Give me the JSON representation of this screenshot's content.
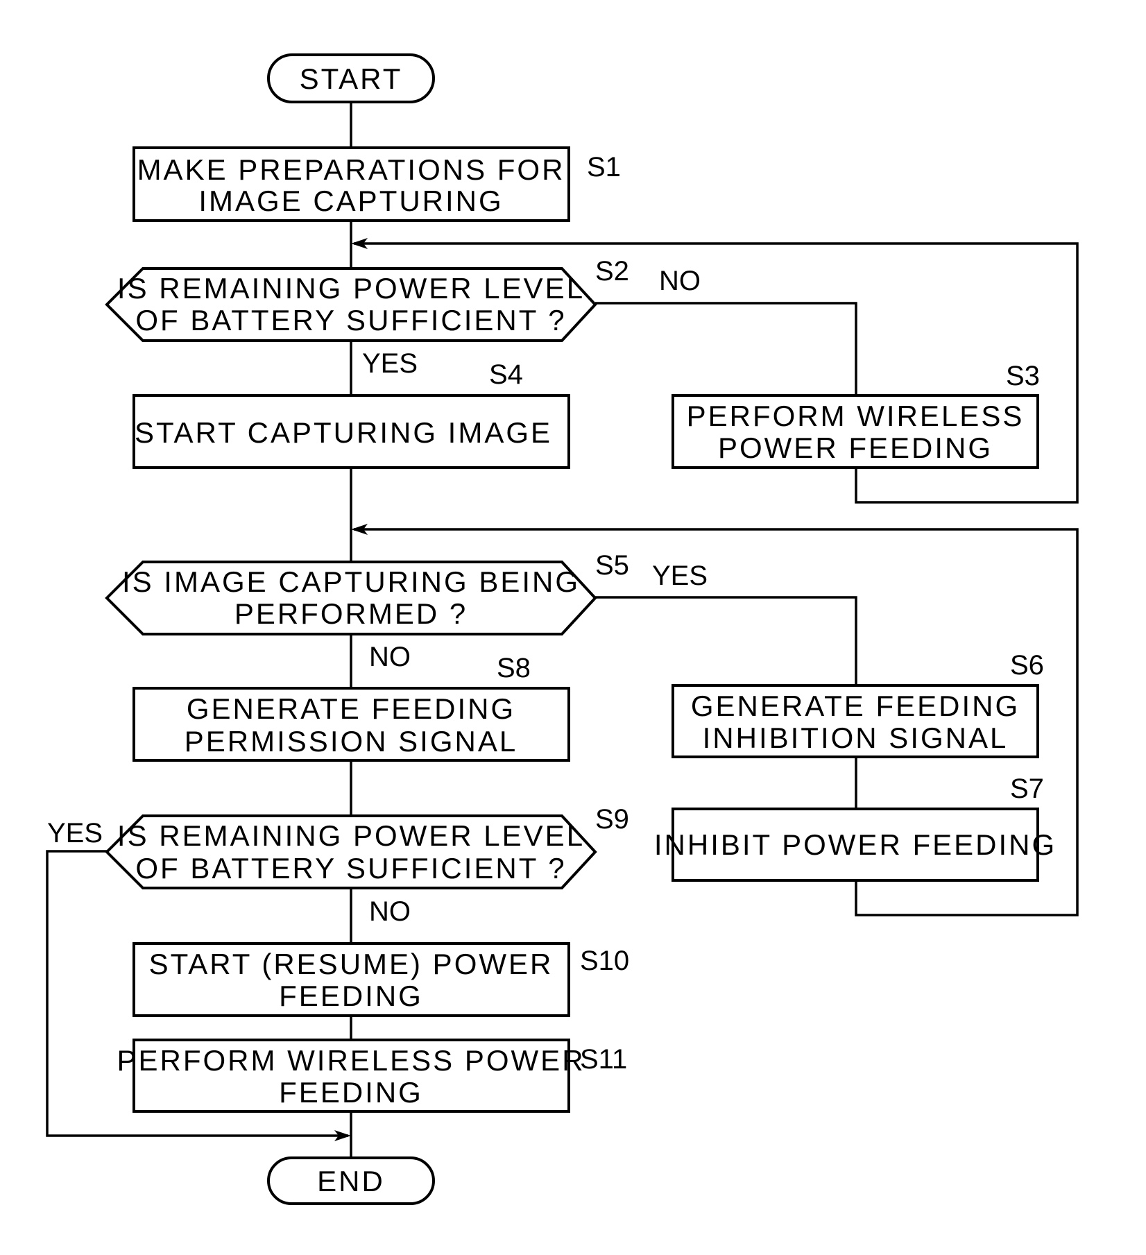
{
  "diagram": {
    "type": "flowchart",
    "terminals": {
      "start": "START",
      "end": "END"
    },
    "steps": {
      "s1": {
        "id": "S1",
        "line1": "MAKE PREPARATIONS FOR",
        "line2": "IMAGE CAPTURING"
      },
      "s2": {
        "id": "S2",
        "line1": "IS REMAINING POWER LEVEL",
        "line2": "OF BATTERY SUFFICIENT ?",
        "yes": "YES",
        "no": "NO"
      },
      "s3": {
        "id": "S3",
        "line1": "PERFORM WIRELESS",
        "line2": "POWER FEEDING"
      },
      "s4": {
        "id": "S4",
        "line1": "START CAPTURING IMAGE"
      },
      "s5": {
        "id": "S5",
        "line1": "IS IMAGE CAPTURING BEING",
        "line2": "PERFORMED ?",
        "yes": "YES",
        "no": "NO"
      },
      "s6": {
        "id": "S6",
        "line1": "GENERATE FEEDING",
        "line2": "INHIBITION SIGNAL"
      },
      "s7": {
        "id": "S7",
        "line1": "INHIBIT POWER FEEDING"
      },
      "s8": {
        "id": "S8",
        "line1": "GENERATE FEEDING",
        "line2": "PERMISSION SIGNAL"
      },
      "s9": {
        "id": "S9",
        "line1": "IS REMAINING POWER LEVEL",
        "line2": "OF BATTERY SUFFICIENT ?",
        "yes": "YES",
        "no": "NO"
      },
      "s10": {
        "id": "S10",
        "line1": "START (RESUME) POWER",
        "line2": "FEEDING"
      },
      "s11": {
        "id": "S11",
        "line1": "PERFORM WIRELESS POWER",
        "line2": "FEEDING"
      }
    }
  }
}
